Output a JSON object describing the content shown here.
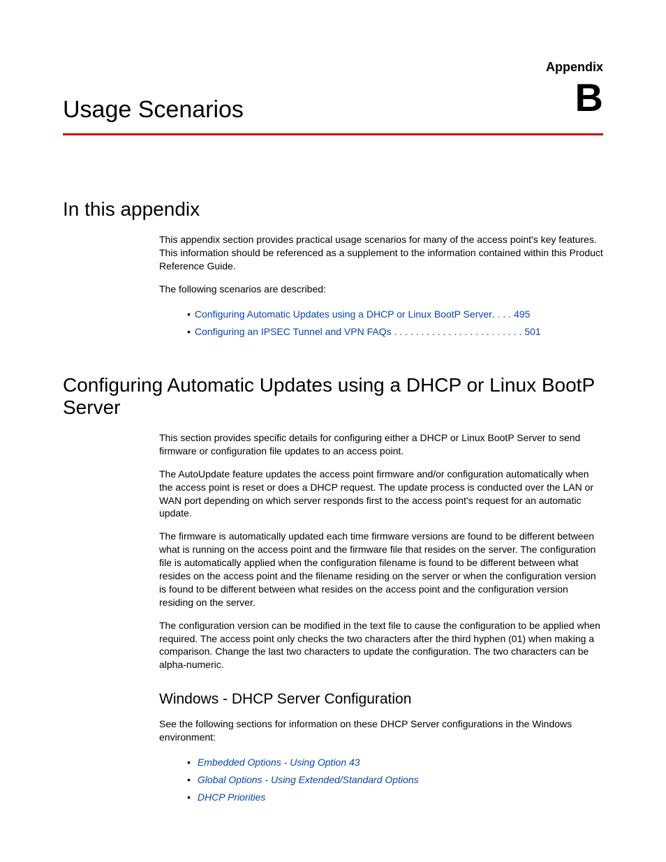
{
  "header": {
    "appendix_label": "Appendix",
    "appendix_letter": "B"
  },
  "chapter_title": "Usage Scenarios",
  "sections": {
    "in_this_appendix": {
      "title": "In this appendix",
      "para1": "This appendix section provides practical usage scenarios for many of the access point's key features. This information should be referenced as a supplement to the information contained within this Product Reference Guide.",
      "para2": "The following scenarios are described:",
      "toc": [
        {
          "text": "Configuring Automatic Updates using a DHCP or Linux BootP Server",
          "dots": ". . . .",
          "page": "495"
        },
        {
          "text": "Configuring an IPSEC Tunnel and VPN FAQs",
          "dots": " . . . . . . . . . . . . . . . . . . . . . . . .",
          "page": "501"
        }
      ]
    },
    "config_auto_updates": {
      "title": "Configuring Automatic Updates using a DHCP or Linux BootP Server",
      "para1": "This section provides specific details for configuring either a DHCP or Linux BootP Server to send firmware or configuration file updates to an access point.",
      "para2": "The AutoUpdate feature updates the access point firmware and/or configuration automatically when the access point is reset or does a DHCP request. The update process is conducted over the LAN or WAN port depending on which server responds first to the access point's request for an automatic update.",
      "para3": "The firmware is automatically updated each time firmware versions are found to be different between what is running on the access point and the firmware file that resides on the server. The configuration file is automatically applied when the configuration filename is found to be different between what resides on the access point and the filename residing on the server or when the configuration version is found to be different between what resides on the access point and the configuration version residing on the server.",
      "para4": "The configuration version can be modified in the text file to cause the configuration to be applied when required. The access point only checks the two characters after the third hyphen (01) when making a comparison. Change the last two characters to update the configuration. The two characters can be alpha-numeric."
    },
    "windows_dhcp": {
      "title": "Windows - DHCP Server Configuration",
      "para1": "See the following sections for information on these DHCP Server configurations in the Windows environment:",
      "links": [
        "Embedded Options - Using Option 43",
        "Global Options - Using Extended/Standard Options",
        "DHCP Priorities"
      ]
    }
  }
}
